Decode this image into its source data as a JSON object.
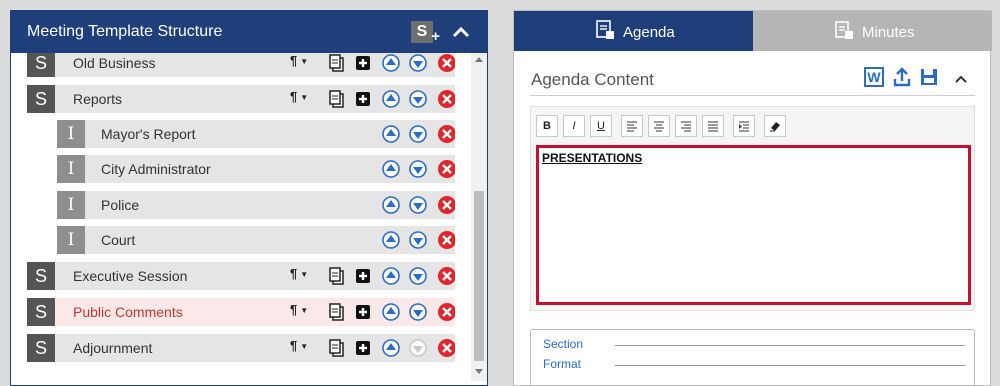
{
  "left_panel": {
    "title": "Meeting Template Structure",
    "add_section_icon": "add-section-icon",
    "collapse_icon": "chevron-up-icon",
    "add_section_letter": "S"
  },
  "tree": {
    "rows": [
      {
        "type": "section",
        "badge": "S",
        "label": "Old Business",
        "controls": [
          "format",
          "copy",
          "add",
          "up",
          "down",
          "delete"
        ],
        "highlight": false
      },
      {
        "type": "section",
        "badge": "S",
        "label": "Reports",
        "controls": [
          "format",
          "copy",
          "add",
          "up",
          "down",
          "delete"
        ],
        "highlight": false
      },
      {
        "type": "item",
        "badge": "I",
        "label": "Mayor's Report",
        "controls": [
          "up",
          "down",
          "delete"
        ],
        "highlight": false
      },
      {
        "type": "item",
        "badge": "I",
        "label": "City Administrator",
        "controls": [
          "up",
          "down",
          "delete"
        ],
        "highlight": false
      },
      {
        "type": "item",
        "badge": "I",
        "label": "Police",
        "controls": [
          "up",
          "down",
          "delete"
        ],
        "highlight": false
      },
      {
        "type": "item",
        "badge": "I",
        "label": "Court",
        "controls": [
          "up",
          "down",
          "delete"
        ],
        "highlight": false
      },
      {
        "type": "section",
        "badge": "S",
        "label": "Executive Session",
        "controls": [
          "format",
          "copy",
          "add",
          "up",
          "down",
          "delete"
        ],
        "highlight": false
      },
      {
        "type": "section",
        "badge": "S",
        "label": "Public Comments",
        "controls": [
          "format",
          "copy",
          "add",
          "up",
          "down",
          "delete"
        ],
        "highlight": true
      },
      {
        "type": "section",
        "badge": "S",
        "label": "Adjournment",
        "controls": [
          "format",
          "copy",
          "add",
          "up",
          "down-disabled",
          "delete"
        ],
        "highlight": false
      }
    ]
  },
  "tabs": [
    {
      "label": "Agenda",
      "icon": "agenda-icon",
      "active": true
    },
    {
      "label": "Minutes",
      "icon": "minutes-icon",
      "active": false
    }
  ],
  "content": {
    "title": "Agenda Content",
    "word_letter": "W",
    "actions": [
      "word-export-icon",
      "upload-icon",
      "save-icon",
      "chevron-up-icon"
    ]
  },
  "toolbar": {
    "bold": "B",
    "italic": "I",
    "underline": "U",
    "buttons": [
      "bold",
      "italic",
      "underline",
      "align-left",
      "align-center",
      "align-right",
      "justify",
      "indent",
      "clear-format"
    ]
  },
  "editor": {
    "text": "PRESENTATIONS"
  },
  "format_box": {
    "section_label": "Section",
    "format_label": "Format"
  },
  "colors": {
    "header_blue": "#1f3f7a",
    "delete_red": "#e0262d",
    "arrow_blue": "#2b6cc4",
    "editor_border": "#c8102e"
  }
}
